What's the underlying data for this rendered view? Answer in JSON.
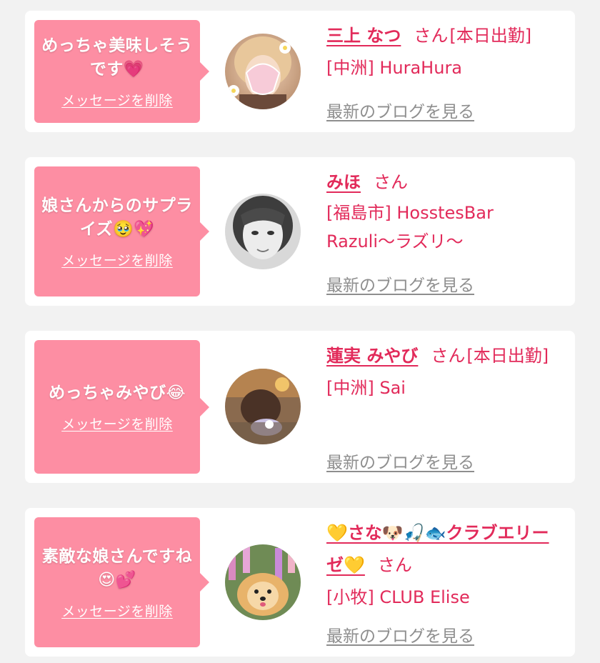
{
  "items": [
    {
      "message": "めっちゃ美味しそうです💗",
      "delete_label": "メッセージを削除",
      "name": "三上 なつ",
      "honorific": "さん",
      "status": "[本日出勤]",
      "area_shop": "[中洲] HuraHura",
      "blog_label": "最新のブログを見る",
      "avatar_icon": "avatar-photo-blonde-woman-thankyou-sticker"
    },
    {
      "message": "娘さんからのサプライズ🥹💖",
      "delete_label": "メッセージを削除",
      "name": "みほ",
      "honorific": "さん",
      "status": "",
      "area_shop": "[福島市] HosstesBar Razuli〜ラズリ〜",
      "blog_label": "最新のブログを見る",
      "avatar_icon": "avatar-photo-monochrome-woman"
    },
    {
      "message": "めっちゃみやび😂",
      "delete_label": "メッセージを削除",
      "name": "蓮実 みやび",
      "honorific": "さん",
      "status": "[本日出勤]",
      "area_shop": "[中洲] Sai",
      "blog_label": "最新のブログを見る",
      "avatar_icon": "avatar-photo-woman-hair-updo"
    },
    {
      "message": "素敵な娘さんですね😍💕",
      "delete_label": "メッセージを削除",
      "name": "💛さな🐶🎣🐟クラブエリーゼ💛",
      "honorific": "さん",
      "status": "",
      "area_shop": "[小牧] CLUB Elise",
      "blog_label": "最新のブログを見る",
      "avatar_icon": "avatar-photo-pomeranian-flowers"
    }
  ],
  "colors": {
    "background": "#f2f2f2",
    "card": "#ffffff",
    "bubble": "#fd8ea3",
    "accent": "#e22a5a",
    "muted": "#8e8e8e"
  }
}
